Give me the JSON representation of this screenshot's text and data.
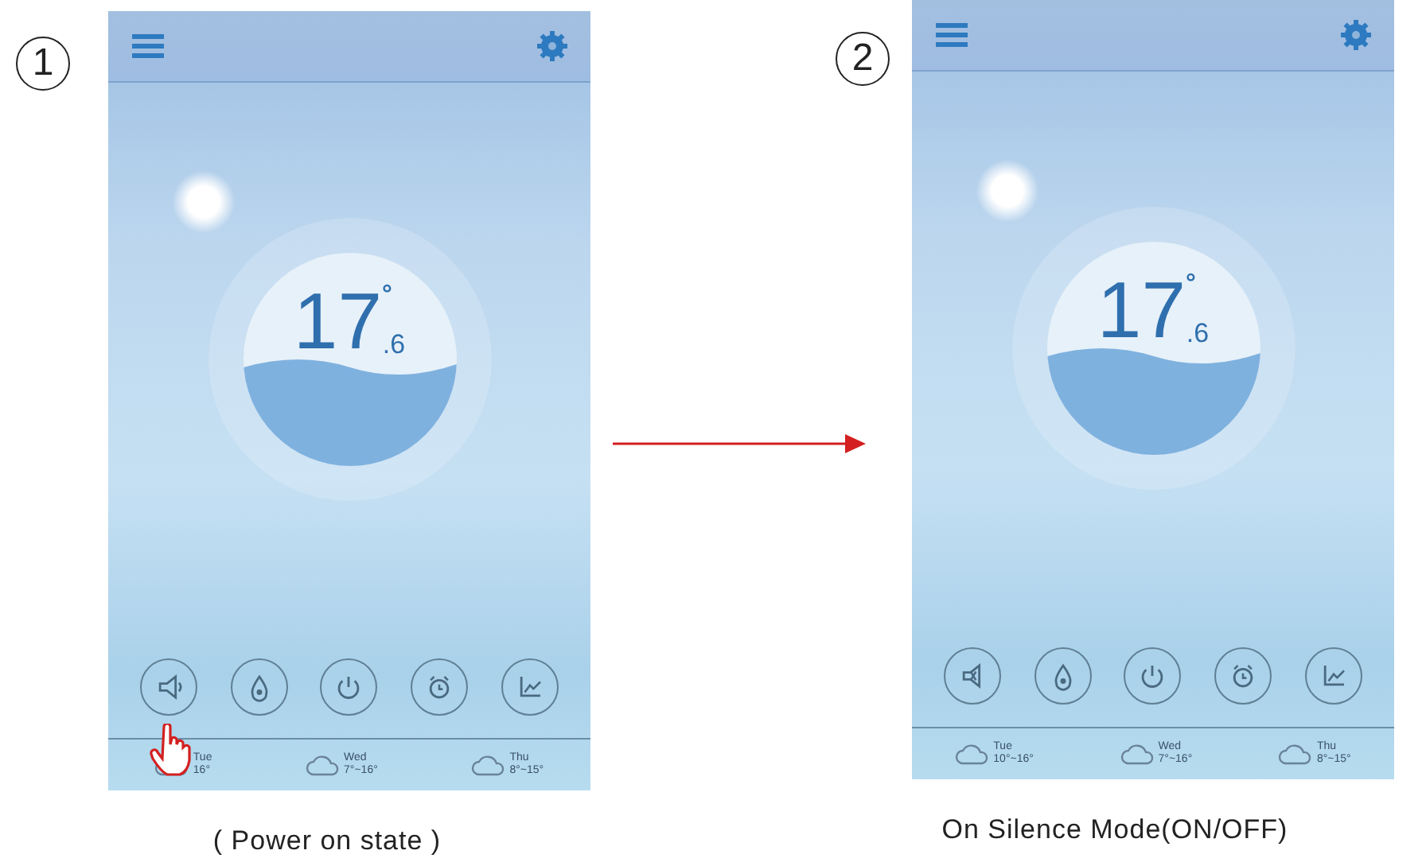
{
  "panels": [
    {
      "step": "1",
      "caption": "( Power on state )",
      "pointer": true,
      "temperature": {
        "whole": "17",
        "degree": "°",
        "decimal": ".6"
      },
      "controls": [
        {
          "kind": "sound",
          "muted": false
        },
        {
          "kind": "drop"
        },
        {
          "kind": "power"
        },
        {
          "kind": "alarm"
        },
        {
          "kind": "chart"
        }
      ],
      "forecast": [
        {
          "day": "Tue",
          "range": "16°"
        },
        {
          "day": "Wed",
          "range": "7°~16°"
        },
        {
          "day": "Thu",
          "range": "8°~15°"
        }
      ]
    },
    {
      "step": "2",
      "caption": "On Silence Mode(ON/OFF)",
      "pointer": false,
      "temperature": {
        "whole": "17",
        "degree": "°",
        "decimal": ".6"
      },
      "controls": [
        {
          "kind": "sound",
          "muted": true
        },
        {
          "kind": "drop"
        },
        {
          "kind": "power"
        },
        {
          "kind": "alarm"
        },
        {
          "kind": "chart"
        }
      ],
      "forecast": [
        {
          "day": "Tue",
          "range": "10°~16°"
        },
        {
          "day": "Wed",
          "range": "7°~16°"
        },
        {
          "day": "Thu",
          "range": "8°~15°"
        }
      ]
    }
  ]
}
